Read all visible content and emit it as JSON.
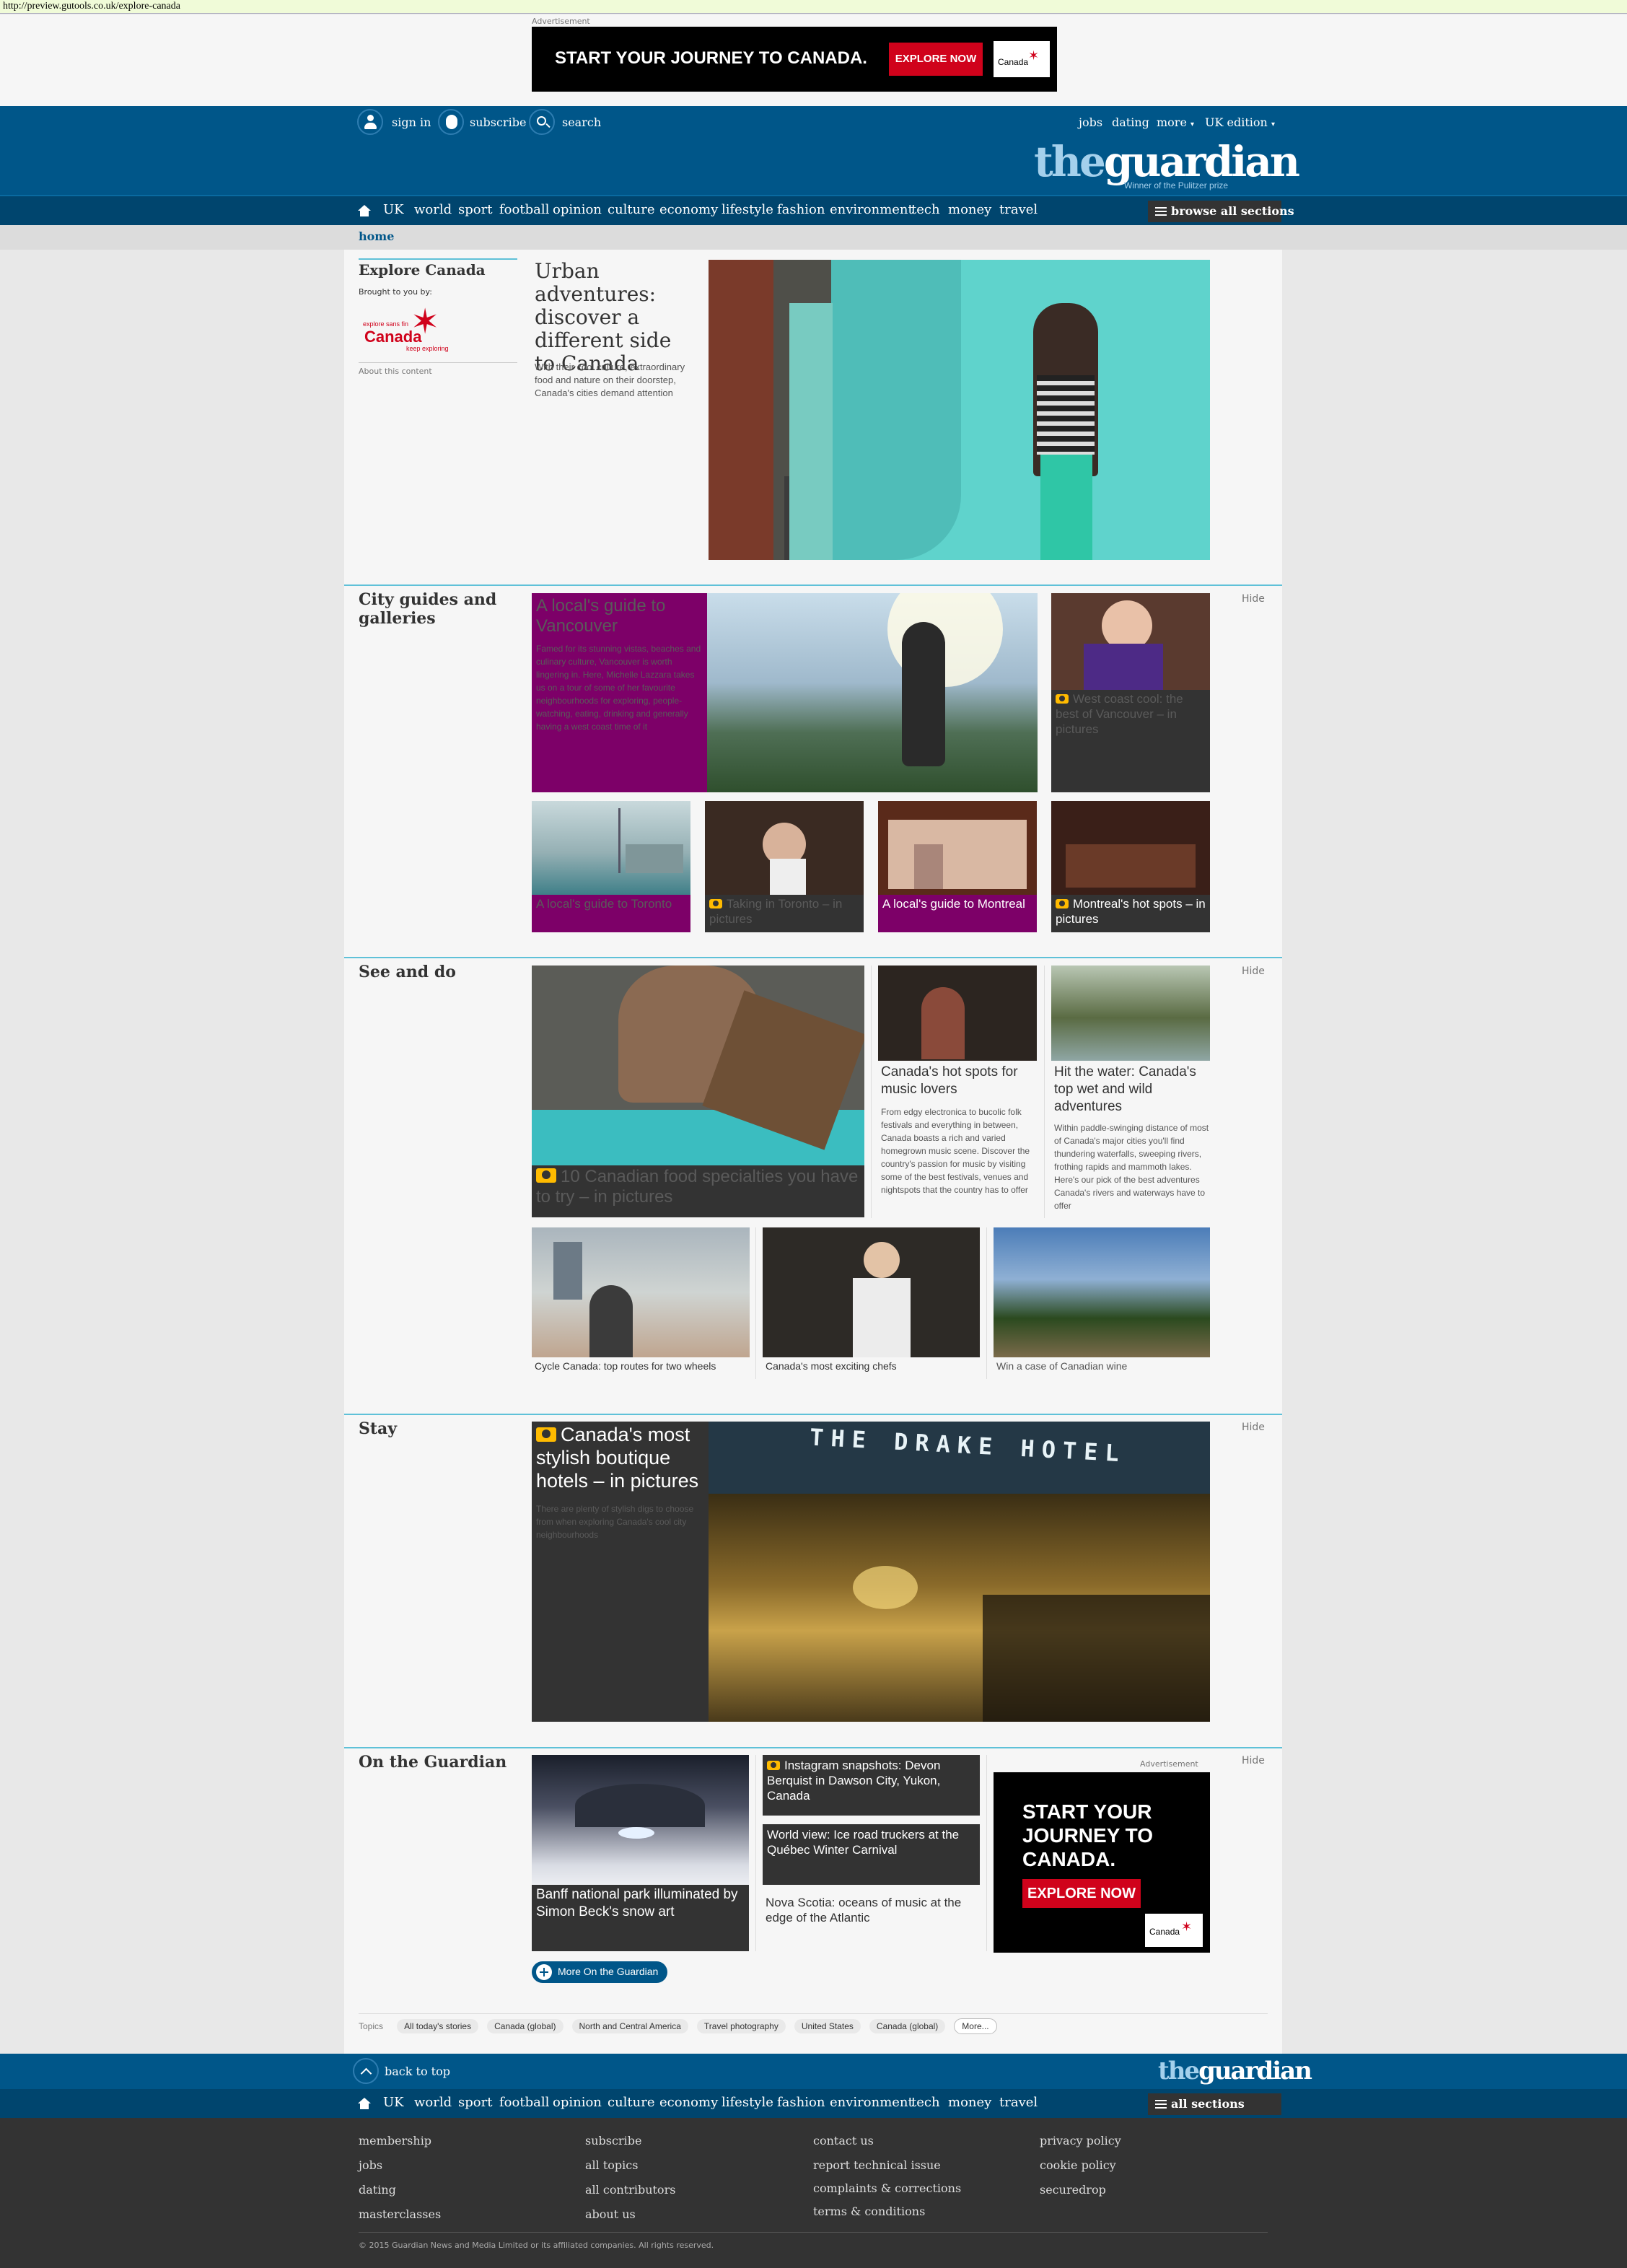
{
  "url": "http://preview.gutools.co.uk/explore-canada",
  "ads": {
    "label": "Advertisement",
    "banner_text": "START YOUR JOURNEY TO CANADA.",
    "banner_cta": "EXPLORE NOW",
    "mpu_text": "START YOUR JOURNEY TO CANADA.",
    "mpu_cta": "EXPLORE NOW",
    "logo_word": "Canada"
  },
  "header": {
    "sign_in": "sign in",
    "subscribe": "subscribe",
    "search": "search",
    "jobs": "jobs",
    "dating": "dating",
    "more": "more",
    "edition": "UK edition",
    "logo_the": "the",
    "logo_guardian": "guardian",
    "tagline": "Winner of the Pulitzer prize"
  },
  "nav": {
    "items": [
      "UK",
      "world",
      "sport",
      "football",
      "opinion",
      "culture",
      "economy",
      "lifestyle",
      "fashion",
      "environment",
      "tech",
      "money",
      "travel"
    ],
    "browse": "browse all sections",
    "all_sections": "all sections"
  },
  "breadcrumb": "home",
  "sponsor": {
    "title": "Explore Canada",
    "brought": "Brought to you by:",
    "logo_line1": "explore sans fin",
    "logo_word": "Canada",
    "logo_line2": "keep exploring",
    "about": "About this content"
  },
  "hero": {
    "headline": "Urban adventures: discover a different side to Canada",
    "standfirst": "With their cool culture, extraordinary food and nature on their doorstep, Canada's cities demand attention"
  },
  "sections": {
    "city": "City guides and galleries",
    "see": "See and do",
    "stay": "Stay",
    "onguardian": "On the Guardian",
    "hide": "Hide"
  },
  "city": {
    "lead_title": "A local's guide to Vancouver",
    "lead_text": "Famed for its stunning vistas, beaches and culinary culture, Vancouver is worth lingering in. Here, Michelle Lazzara takes us on a tour of some of her favourite neighbourhoods for exploring, people-watching, eating, drinking and generally having a west coast time of it",
    "west_coast": "West coast cool: the best of Vancouver – in pictures",
    "toronto_guide": "A local's guide to Toronto",
    "toronto_pics": "Taking in Toronto – in pictures",
    "montreal_guide": "A local's guide to Montreal",
    "montreal_pics": "Montreal's hot spots – in pictures"
  },
  "see": {
    "food": "10 Canadian food specialties you have to try – in pictures",
    "music_title": "Canada's hot spots for music lovers",
    "music_text": "From edgy electronica to bucolic folk festivals and everything in between, Canada boasts a rich and varied homegrown music scene. Discover the country's passion for music by visiting some of the best festivals, venues and nightspots that the country has to offer",
    "water_title": "Hit the water: Canada's top wet and wild adventures",
    "water_text": "Within paddle-swinging distance of most of Canada's major cities you'll find thundering waterfalls, sweeping rivers, frothing rapids and mammoth lakes. Here's our pick of the best adventures Canada's rivers and waterways have to offer",
    "cycle": "Cycle Canada: top routes for two wheels",
    "chefs": "Canada's most exciting chefs",
    "wine": "Win a case of Canadian wine"
  },
  "stay": {
    "title": "Canada's most stylish boutique hotels – in pictures",
    "text": "There are plenty of stylish digs to choose from when exploring Canada's cool city neighbourhoods",
    "hotel_sign": "THE DRAKE HOTEL"
  },
  "onguardian": {
    "banff": "Banff national park illuminated by Simon Beck's snow art",
    "instagram": "Instagram snapshots: Devon Berquist in Dawson City, Yukon, Canada",
    "worldview": "World view: Ice road truckers at the Québec Winter Carnival",
    "novascotia": "Nova Scotia: oceans of music at the edge of the Atlantic",
    "more_button": "More On the Guardian"
  },
  "topics": {
    "label": "Topics",
    "items": [
      "All today's stories",
      "Canada (global)",
      "North and Central America",
      "Travel photography",
      "United States",
      "Canada (global)",
      "More..."
    ]
  },
  "back_to_top": "back to top",
  "footer": {
    "col1": [
      "membership",
      "jobs",
      "dating",
      "masterclasses"
    ],
    "col2": [
      "subscribe",
      "all topics",
      "all contributors",
      "about us"
    ],
    "col3": [
      "contact us",
      "report technical issue",
      "complaints & corrections",
      "terms & conditions"
    ],
    "col4": [
      "privacy policy",
      "cookie policy",
      "securedrop"
    ],
    "copyright": "© 2015 Guardian News and Media Limited or its affiliated companies. All rights reserved."
  },
  "colors": {
    "header_blue": "#005689",
    "nav_blue": "#00456e",
    "accent_teal": "#5fc1d8",
    "magenta": "#7d0068",
    "red": "#d0021b",
    "camera_yellow": "#ffbb00"
  }
}
